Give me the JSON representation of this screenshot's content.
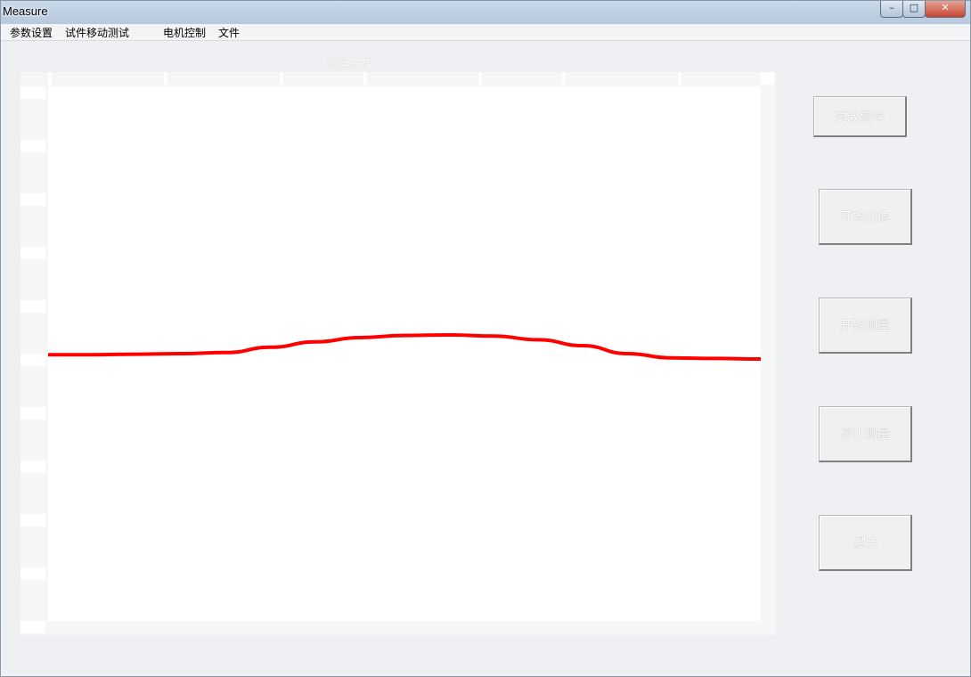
{
  "window": {
    "title": "Measure",
    "controls": {
      "minimize": "–",
      "maximize": "□",
      "close": "✕"
    }
  },
  "menu": {
    "items": [
      "参数设置",
      "试件移动测试",
      "电机控制",
      "文件"
    ]
  },
  "status_text": "测量完成……",
  "buttons": {
    "change_signal": "更改信号",
    "start_calibration": "开始成像",
    "start_measurement": "开始测量",
    "stop_measurement": "停止测量",
    "exit": "退出"
  },
  "chart_data": {
    "type": "line",
    "series": [
      {
        "color": "#ff0000",
        "x": [
          0,
          50,
          100,
          150,
          200,
          250,
          300,
          350,
          400,
          450,
          500,
          550,
          600,
          650,
          700,
          750,
          800
        ],
        "y": [
          0.498,
          0.498,
          0.499,
          0.5,
          0.502,
          0.512,
          0.522,
          0.53,
          0.534,
          0.535,
          0.533,
          0.526,
          0.515,
          0.5,
          0.492,
          0.491,
          0.49
        ]
      }
    ],
    "xlim": [
      0,
      800
    ],
    "ylim": [
      0,
      1
    ],
    "line_color": "#ff0000"
  }
}
